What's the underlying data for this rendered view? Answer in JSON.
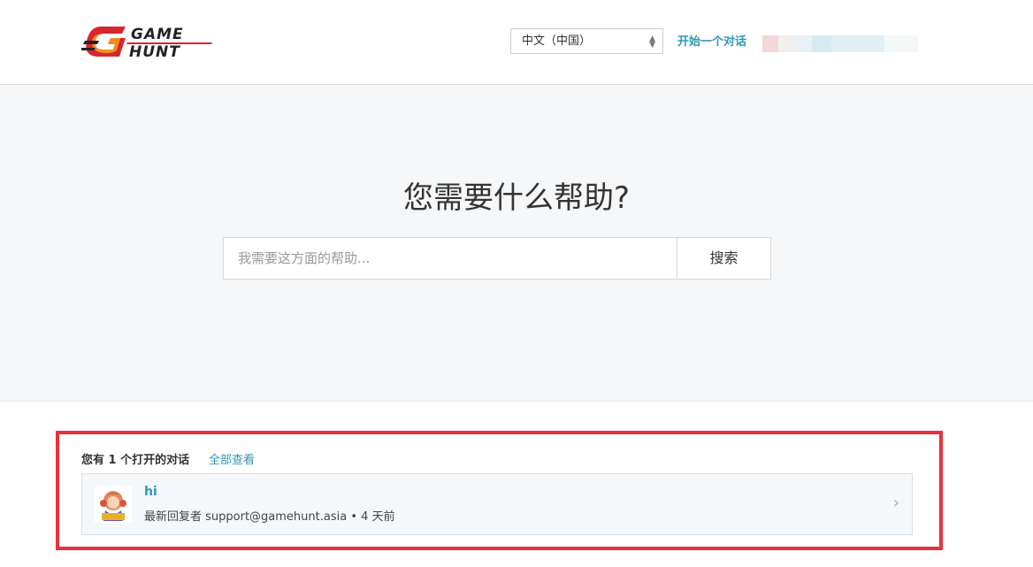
{
  "brand": {
    "logo_line1": "GAME",
    "logo_line2": "HUNT"
  },
  "header": {
    "language_selected": "中文（中国）",
    "start_conversation": "开始一个对话"
  },
  "hero": {
    "title": "您需要什么帮助?",
    "search_placeholder": "我需要这方面的帮助...",
    "search_button": "搜索"
  },
  "conversations": {
    "heading": "您有 1 个打开的对话",
    "view_all": "全部查看",
    "items": [
      {
        "title": "hi",
        "meta": "最新回复者 support@gamehunt.asia • 4 天前"
      }
    ]
  },
  "colors": {
    "accent": "#3097b6",
    "highlight_border": "#e7323a",
    "logo_red": "#d7262d",
    "logo_orange": "#f39a1e"
  }
}
